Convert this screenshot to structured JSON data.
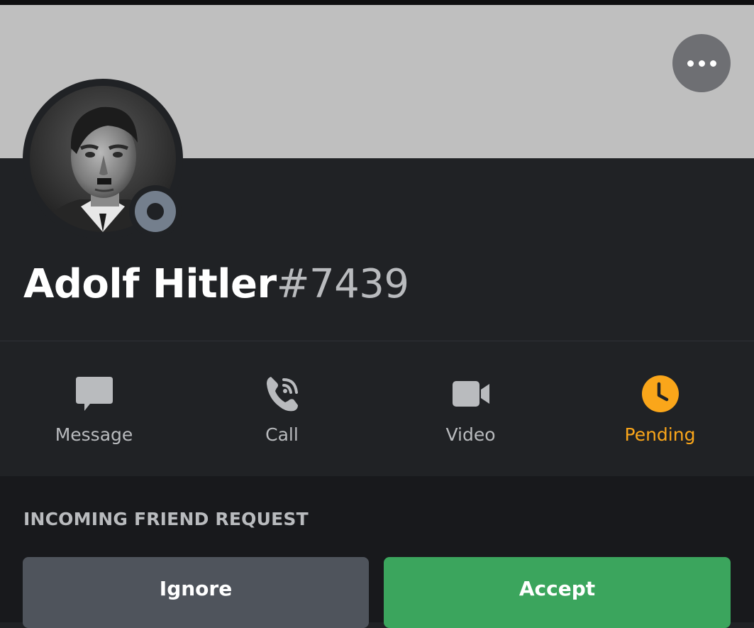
{
  "profile": {
    "username": "Adolf Hitler",
    "discriminator": "#7439",
    "status": "offline"
  },
  "header": {
    "more_icon": "more-horizontal-icon"
  },
  "actions": [
    {
      "label": "Message",
      "icon": "chat-bubble-icon",
      "color": "#b9bbbe"
    },
    {
      "label": "Call",
      "icon": "phone-call-icon",
      "color": "#b9bbbe"
    },
    {
      "label": "Video",
      "icon": "video-camera-icon",
      "color": "#b9bbbe"
    },
    {
      "label": "Pending",
      "icon": "clock-icon",
      "color": "#faa61a"
    }
  ],
  "friend_request": {
    "heading": "INCOMING FRIEND REQUEST",
    "ignore_label": "Ignore",
    "accept_label": "Accept"
  },
  "colors": {
    "banner": "#bfbfbf",
    "background": "#202225",
    "accept": "#3ba55d",
    "ignore": "#4f545c",
    "pending": "#faa61a",
    "status_offline": "#747f8d"
  }
}
